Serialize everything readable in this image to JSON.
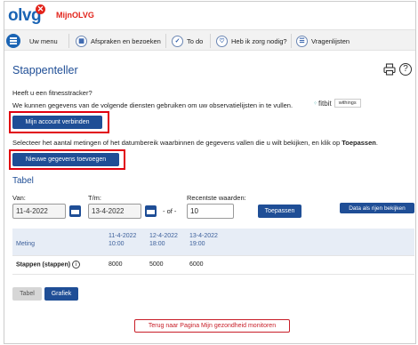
{
  "header": {
    "logo_text": "olvg",
    "app_name": "MijnOLVG"
  },
  "nav": {
    "menu_label": "Uw menu",
    "items": [
      {
        "label": "Afspraken en bezoeken"
      },
      {
        "label": "To do"
      },
      {
        "label": "Heb ik zorg nodig?"
      },
      {
        "label": "Vragenlijsten"
      }
    ]
  },
  "page": {
    "title": "Stappenteller",
    "fitness_question": "Heeft u een fitnesstracker?",
    "services_text": "We kunnen gegevens van de volgende diensten gebruiken om uw observatielijsten in te vullen.",
    "brand_fitbit": "fitbit",
    "brand_withings": "withings",
    "connect_button": "Mijn account verbinden",
    "instructions_prefix": "Selecteer het aantal metingen of het datumbereik waarbinnen de gegevens vallen die u wilt bekijken, en klik op ",
    "instructions_bold": "Toepassen",
    "instructions_suffix": ".",
    "add_data_button": "Nieuwe gegevens toevoegen"
  },
  "tabel": {
    "section_title": "Tabel",
    "from_label": "Van:",
    "from_value": "11-4-2022",
    "to_label": "T/m:",
    "to_value": "13-4-2022",
    "range_sep": "- of -",
    "recent_label": "Recentste waarden:",
    "recent_value": "10",
    "apply_button": "Toepassen",
    "rows_button": "Data als rijen bekijken",
    "columns": [
      {
        "date": "11-4-2022",
        "time": "10:00"
      },
      {
        "date": "12-4-2022",
        "time": "18:00"
      },
      {
        "date": "13-4-2022",
        "time": "19:00"
      }
    ],
    "measure_header": "Meting",
    "row_label": "Stappen (stappen)",
    "row_values": [
      "8000",
      "5000",
      "6000"
    ]
  },
  "view_buttons": {
    "table": "Tabel",
    "chart": "Grafiek"
  },
  "back_button": "Terug naar Pagina Mijn gezondheid monitoren",
  "colors": {
    "brand_blue": "#1f4e96",
    "accent_red": "#e2231a",
    "highlight_red": "#e1000f"
  }
}
